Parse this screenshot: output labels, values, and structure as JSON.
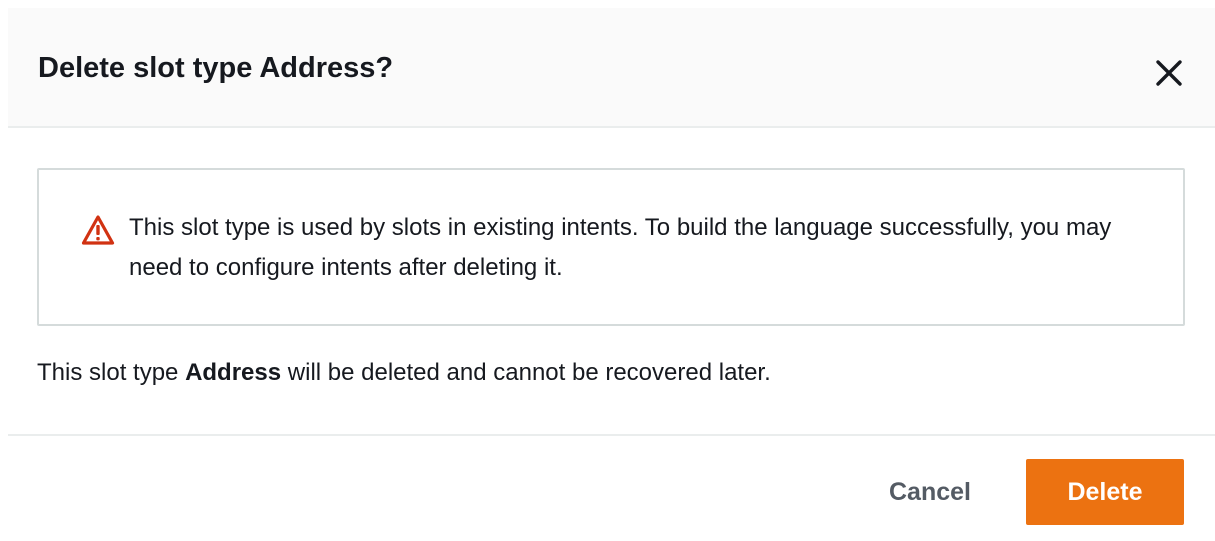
{
  "dialog": {
    "title": "Delete slot type Address?",
    "close_icon": "close-icon"
  },
  "alert": {
    "icon": "warning-icon",
    "icon_color": "#d13212",
    "message": "This slot type is used by slots in existing intents. To build the language successfully, you may need to configure intents after deleting it."
  },
  "body": {
    "prefix": "This slot type ",
    "name": "Address",
    "suffix": " will be deleted and cannot be recovered later."
  },
  "footer": {
    "cancel_label": "Cancel",
    "delete_label": "Delete"
  },
  "colors": {
    "primary_button": "#ec7211",
    "text": "#16191f",
    "secondary_text": "#545b64",
    "warning": "#d13212"
  }
}
